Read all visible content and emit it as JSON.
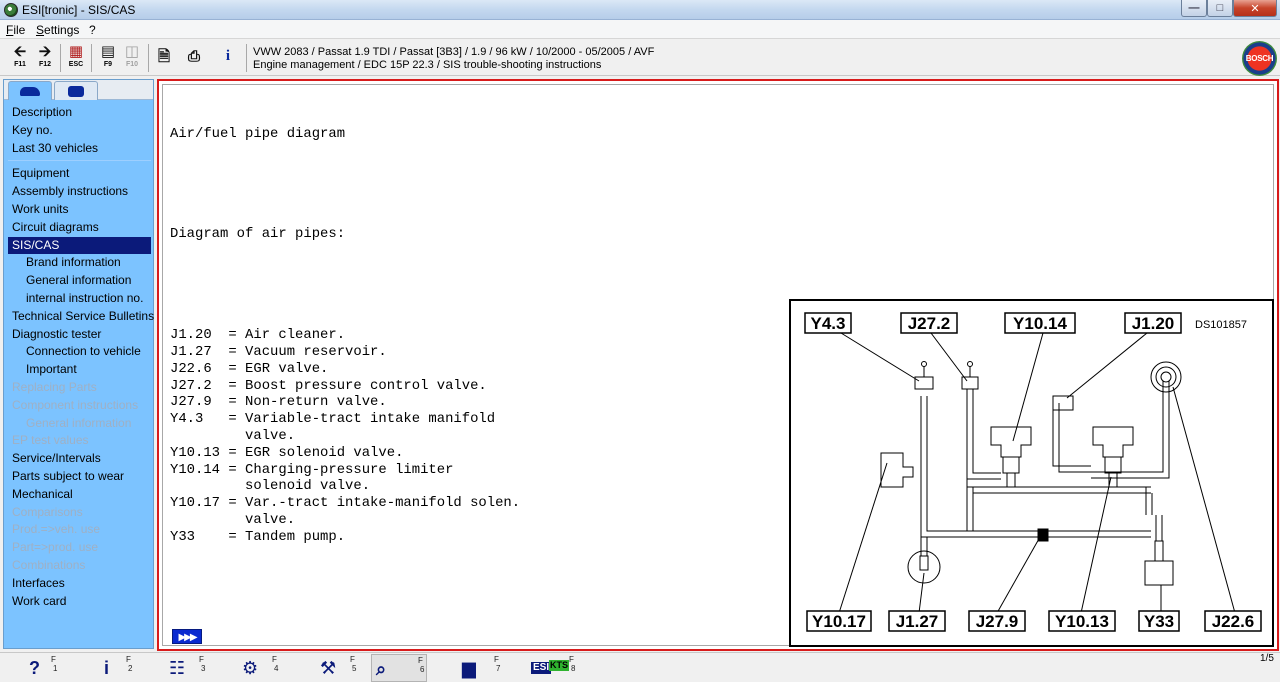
{
  "window": {
    "title": "ESI[tronic] - SIS/CAS",
    "minimize": "—",
    "maximize": "□",
    "close": "✕"
  },
  "menu": {
    "file": "File",
    "settings": "Settings",
    "help": "?"
  },
  "toolbar": {
    "back_key": "F11",
    "forward_key": "F12",
    "esc_key": "ESC",
    "f9_key": "F9",
    "f10_key": "F10",
    "vehicle_line": "VWW 2083 / Passat 1.9 TDI / Passat [3B3] / 1.9 / 96 kW / 10/2000 - 05/2005 / AVF",
    "path_line": "Engine management / EDC 15P 22.3 / SIS trouble-shooting instructions",
    "logo_text": "BOSCH",
    "icons": [
      "arrow-left-icon",
      "arrow-right-icon",
      "esc-icon",
      "f9-icon",
      "f10-icon",
      "document-icon",
      "printer-icon",
      "info-icon"
    ]
  },
  "sidebar": {
    "items": [
      {
        "label": "Description",
        "state": "normal"
      },
      {
        "label": "Key no.",
        "state": "normal"
      },
      {
        "label": "Last 30 vehicles",
        "state": "normal"
      },
      {
        "label": "Equipment",
        "state": "normal"
      },
      {
        "label": "Assembly instructions",
        "state": "normal"
      },
      {
        "label": "Work units",
        "state": "normal"
      },
      {
        "label": "Circuit diagrams",
        "state": "normal"
      },
      {
        "label": "SIS/CAS",
        "state": "selected"
      },
      {
        "label": "Brand information",
        "state": "sub"
      },
      {
        "label": "General information",
        "state": "sub"
      },
      {
        "label": "internal instruction no.",
        "state": "sub"
      },
      {
        "label": "Technical Service Bulletins",
        "state": "normal"
      },
      {
        "label": "Diagnostic tester",
        "state": "normal"
      },
      {
        "label": "Connection to vehicle",
        "state": "sub"
      },
      {
        "label": "Important",
        "state": "sub"
      },
      {
        "label": "Replacing Parts",
        "state": "disabled"
      },
      {
        "label": "Component instructions",
        "state": "disabled"
      },
      {
        "label": "General information",
        "state": "disabled-sub"
      },
      {
        "label": "EP test values",
        "state": "disabled"
      },
      {
        "label": "Service/Intervals",
        "state": "normal"
      },
      {
        "label": "Parts subject to wear",
        "state": "normal"
      },
      {
        "label": "Mechanical",
        "state": "normal"
      },
      {
        "label": "Comparisons",
        "state": "disabled"
      },
      {
        "label": "Prod.=>veh. use",
        "state": "disabled"
      },
      {
        "label": "Part=>prod. use",
        "state": "disabled"
      },
      {
        "label": "Combinations",
        "state": "disabled"
      },
      {
        "label": "Interfaces",
        "state": "normal"
      },
      {
        "label": "Work card",
        "state": "normal"
      }
    ]
  },
  "document": {
    "title": "Air/fuel pipe diagram",
    "subtitle": "Diagram of air pipes:",
    "lines": [
      "J1.20  = Air cleaner.",
      "J1.27  = Vacuum reservoir.",
      "J22.6  = EGR valve.",
      "J27.2  = Boost pressure control valve.",
      "J27.9  = Non-return valve.",
      "Y4.3   = Variable-tract intake manifold",
      "         valve.",
      "Y10.13 = EGR solenoid valve.",
      "Y10.14 = Charging-pressure limiter",
      "         solenoid valve.",
      "Y10.17 = Var.-tract intake-manifold solen.",
      "         valve.",
      "Y33    = Tandem pump."
    ],
    "nav_arrows": "▶▶▶"
  },
  "diagram": {
    "ref": "DS101857",
    "top_labels": [
      "Y4.3",
      "J27.2",
      "Y10.14",
      "J1.20"
    ],
    "bottom_labels": [
      "Y10.17",
      "J1.27",
      "J27.9",
      "Y10.13",
      "Y33",
      "J22.6"
    ]
  },
  "bottombar": {
    "buttons": [
      {
        "glyph": "?",
        "key": "F",
        "num": "1",
        "icon": "help-icon"
      },
      {
        "glyph": "i",
        "key": "F",
        "num": "2",
        "icon": "info-icon"
      },
      {
        "glyph": "☷",
        "key": "F",
        "num": "3",
        "icon": "circuit-icon"
      },
      {
        "glyph": "⚙",
        "key": "F",
        "num": "4",
        "icon": "vehicle-system-icon"
      },
      {
        "glyph": "⚒",
        "key": "F",
        "num": "5",
        "icon": "repair-icon"
      },
      {
        "glyph": "⌕",
        "key": "F",
        "num": "6",
        "icon": "zoom-icon"
      },
      {
        "glyph": "▆",
        "key": "F",
        "num": "7",
        "icon": "car-icon"
      },
      {
        "glyph": "ESI",
        "key": "F",
        "num": "8",
        "icon": "esi-kts-icon"
      }
    ],
    "kts_text": "KTS",
    "page": "1/5"
  }
}
